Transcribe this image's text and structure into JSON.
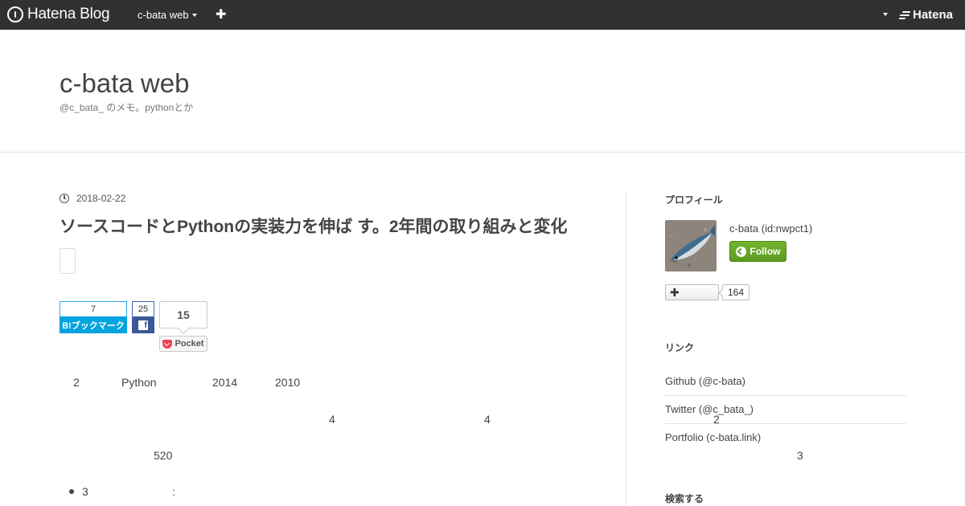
{
  "globalheader": {
    "logo_text": "Hatena Blog",
    "blog_switch_label": "c-bata web",
    "add_label": "✚",
    "brand_text": "Hatena"
  },
  "blog": {
    "title": "c-bata web",
    "description": "@c_bata_ のメモ。pythonとか"
  },
  "entry": {
    "date": "2018-02-22",
    "title": "ソースコードとPythonの実装力を伸ば す。2年間の取り組みと変化",
    "share": {
      "hatena_count": "7",
      "hatena_label": "B!ブックマーク",
      "facebook_count": "25",
      "facebook_icon": "f",
      "pocket_count": "15",
      "pocket_label": "Pocket"
    },
    "body_fragments": {
      "p1_a": "2",
      "p1_b": "Python",
      "p1_c": "2014",
      "p1_d": "2010",
      "p2_a": "4",
      "p2_b": "4",
      "p3_a": "520",
      "li_a": "3",
      "li_b": ":"
    }
  },
  "sidebar": {
    "profile_heading": "プロフィール",
    "user_name": "c-bata (id:nwpct1)",
    "follow_label": "Follow",
    "subscribe_label": "✚",
    "subscriber_count": "164",
    "links_heading": "リンク",
    "links": [
      "Github (@c-bata)",
      "Twitter (@c_bata_)",
      "Portfolio (c-bata.link)"
    ],
    "overlap_fragments": {
      "a": "2",
      "b": "3"
    },
    "search_heading": "検索する"
  }
}
